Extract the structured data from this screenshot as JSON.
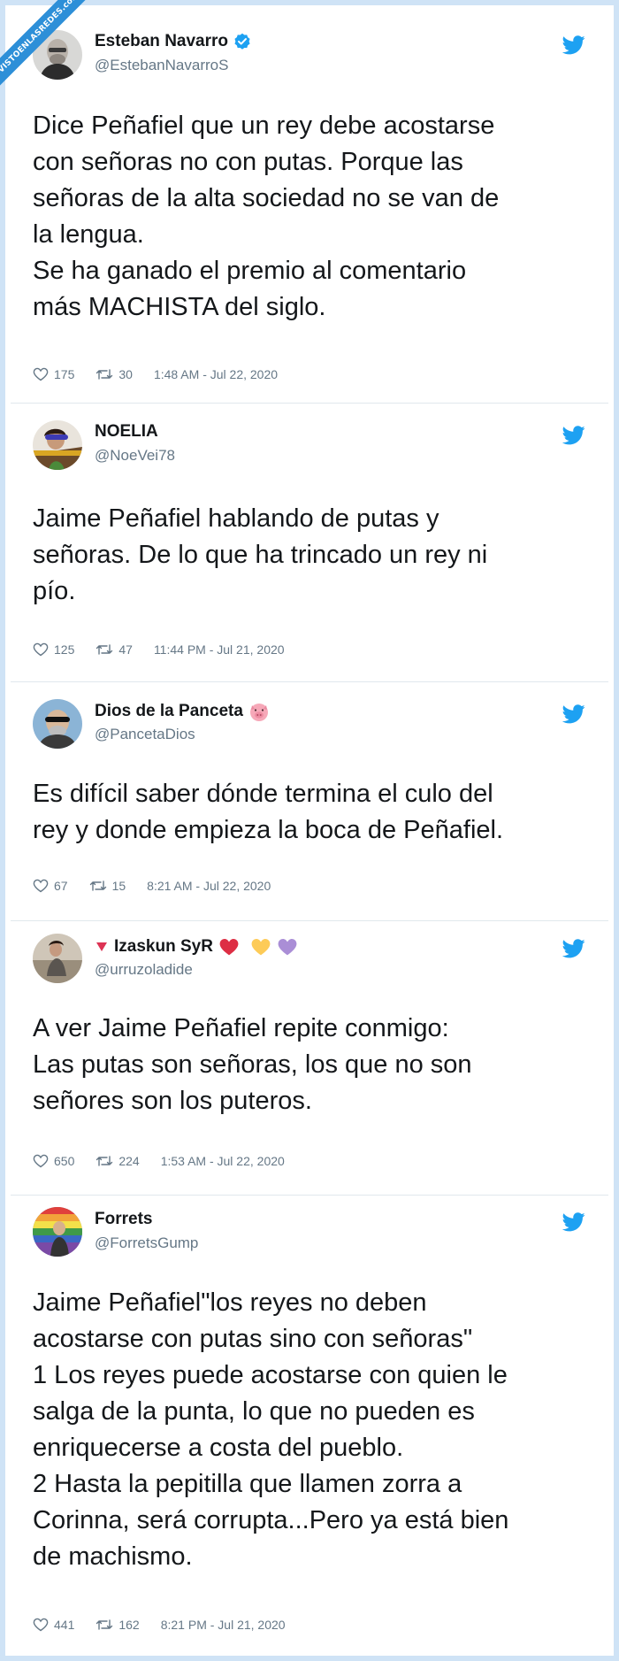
{
  "watermark": "VISTOENLASREDES.com",
  "colors": {
    "accent": "#1da1f2",
    "muted": "#657786",
    "border": "#cfe3f6"
  },
  "tweets": [
    {
      "name": "Esteban Navarro",
      "handle": "@EstebanNavarroS",
      "verified": true,
      "text": "Dice Peñafiel que un rey debe acostarse\ncon señoras no con putas. Porque las\nseñoras de la alta sociedad no se van de\nla lengua.\nSe ha ganado el premio al comentario\nmás MACHISTA del siglo.",
      "likes": "175",
      "retweets": "30",
      "time": "1:48 AM - Jul 22, 2020"
    },
    {
      "name": "NOELIA",
      "handle": "@NoeVei78",
      "text": "Jaime Peñafiel hablando de putas y\nseñoras. De lo que ha trincado un rey ni\npío.",
      "likes": "125",
      "retweets": "47",
      "time": "11:44 PM - Jul 21, 2020"
    },
    {
      "name": "Dios de la Panceta",
      "name_emoji": "pig-face-icon",
      "handle": "@PancetaDios",
      "text": "Es difícil saber dónde termina el culo del\nrey y donde empieza la boca de Peñafiel.",
      "likes": "67",
      "retweets": "15",
      "time": "8:21 AM - Jul 22, 2020"
    },
    {
      "name": "Izaskun SyR",
      "name_emojis": [
        "red-triangle-icon",
        "red-heart-icon",
        "yellow-heart-icon",
        "purple-heart-icon"
      ],
      "handle": "@urruzoladide",
      "text": "A ver Jaime Peñafiel repite conmigo:\nLas putas son señoras, los que no son\nseñores son los puteros.",
      "likes": "650",
      "retweets": "224",
      "time": "1:53 AM - Jul 22, 2020"
    },
    {
      "name": "Forrets",
      "handle": "@ForretsGump",
      "text": "Jaime Peñafiel\"los reyes no deben\nacostarse con putas sino con señoras\"\n1 Los reyes puede acostarse con quien le\nsalga de la punta, lo que no pueden es\nenriquecerse a costa del pueblo.\n2 Hasta la pepitilla que llamen zorra a\nCorinna, será corrupta...Pero ya está bien\nde machismo.",
      "likes": "441",
      "retweets": "162",
      "time": "8:21 PM - Jul 21, 2020"
    }
  ]
}
